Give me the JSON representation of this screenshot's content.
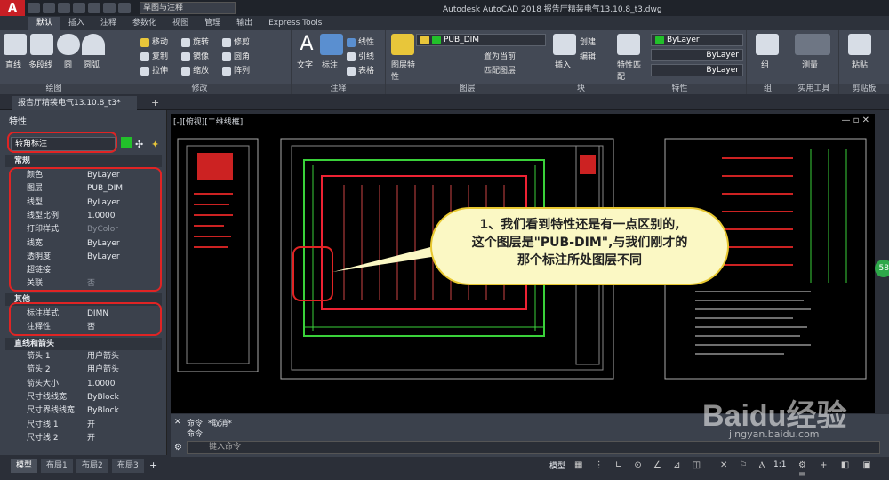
{
  "app": {
    "logo": "A",
    "workspace": "草图与注释",
    "title": "Autodesk AutoCAD 2018    报告厅精装电气13.10.8_t3.dwg"
  },
  "ribbon_tabs": [
    "默认",
    "插入",
    "注释",
    "参数化",
    "视图",
    "管理",
    "输出",
    "Express Tools"
  ],
  "panels": {
    "draw": {
      "label": "绘图",
      "items": [
        "直线",
        "多段线",
        "圆",
        "圆弧"
      ]
    },
    "modify": {
      "label": "修改",
      "items": [
        "移动",
        "旋转",
        "修剪",
        "复制",
        "镜像",
        "圆角",
        "拉伸",
        "缩放",
        "阵列"
      ]
    },
    "annotation": {
      "label": "注释",
      "items": [
        "文字",
        "标注",
        "线性",
        "引线",
        "表格"
      ]
    },
    "layers": {
      "label": "图层",
      "items": [
        "图层特性",
        "置为当前",
        "匹配图层"
      ],
      "current_layer": "PUB_DIM"
    },
    "block": {
      "label": "块",
      "items": [
        "插入",
        "创建",
        "编辑"
      ]
    },
    "properties": {
      "label": "特性",
      "items": [
        "特性匹配"
      ],
      "color": "ByLayer",
      "linetype": "ByLayer",
      "lineweight": "ByLayer"
    },
    "groups": {
      "label": "组",
      "items": [
        "组"
      ]
    },
    "utilities": {
      "label": "实用工具",
      "items": [
        "测量"
      ]
    },
    "clipboard": {
      "label": "剪贴板",
      "items": [
        "粘贴"
      ]
    }
  },
  "doc_tab": "报告厅精装电气13.10.8_t3*",
  "properties_panel": {
    "title": "特性",
    "selector": "转角标注",
    "sections": {
      "general": "常规",
      "misc": "其他",
      "lines": "直线和箭头"
    },
    "general": [
      {
        "k": "颜色",
        "v": "ByLayer"
      },
      {
        "k": "图层",
        "v": "PUB_DIM"
      },
      {
        "k": "线型",
        "v": "ByLayer"
      },
      {
        "k": "线型比例",
        "v": "1.0000"
      },
      {
        "k": "打印样式",
        "v": "ByColor"
      },
      {
        "k": "线宽",
        "v": "ByLayer"
      },
      {
        "k": "透明度",
        "v": "ByLayer"
      },
      {
        "k": "超链接",
        "v": ""
      },
      {
        "k": "关联",
        "v": "否"
      }
    ],
    "misc": [
      {
        "k": "标注样式",
        "v": "DIMN"
      },
      {
        "k": "注释性",
        "v": "否"
      }
    ],
    "lines": [
      {
        "k": "箭头 1",
        "v": "用户箭头"
      },
      {
        "k": "箭头 2",
        "v": "用户箭头"
      },
      {
        "k": "箭头大小",
        "v": "1.0000"
      },
      {
        "k": "尺寸线线宽",
        "v": "ByBlock"
      },
      {
        "k": "尺寸界线线宽",
        "v": "ByBlock"
      },
      {
        "k": "尺寸线 1",
        "v": "开"
      },
      {
        "k": "尺寸线 2",
        "v": "开"
      }
    ]
  },
  "viewport_label": "[-][俯视][二维线框]",
  "callout": [
    "1、我们看到特性还是有一点区别的,",
    "这个图层是\"PUB-DIM\",与我们刚才的",
    "那个标注所处图层不同"
  ],
  "command": {
    "history": [
      "命令: *取消*",
      "命令:"
    ],
    "placeholder": "键入命令"
  },
  "layout_tabs": [
    "模型",
    "布局1",
    "布局2",
    "布局3"
  ],
  "status": {
    "model": "模型",
    "scale": "1:1"
  },
  "watermark": {
    "brand": "Baidu经验",
    "url": "jingyan.baidu.com"
  },
  "badge": "58",
  "colors": {
    "accent": "#2e8ce0",
    "layer_green": "#22c02a",
    "red": "#e02424"
  }
}
